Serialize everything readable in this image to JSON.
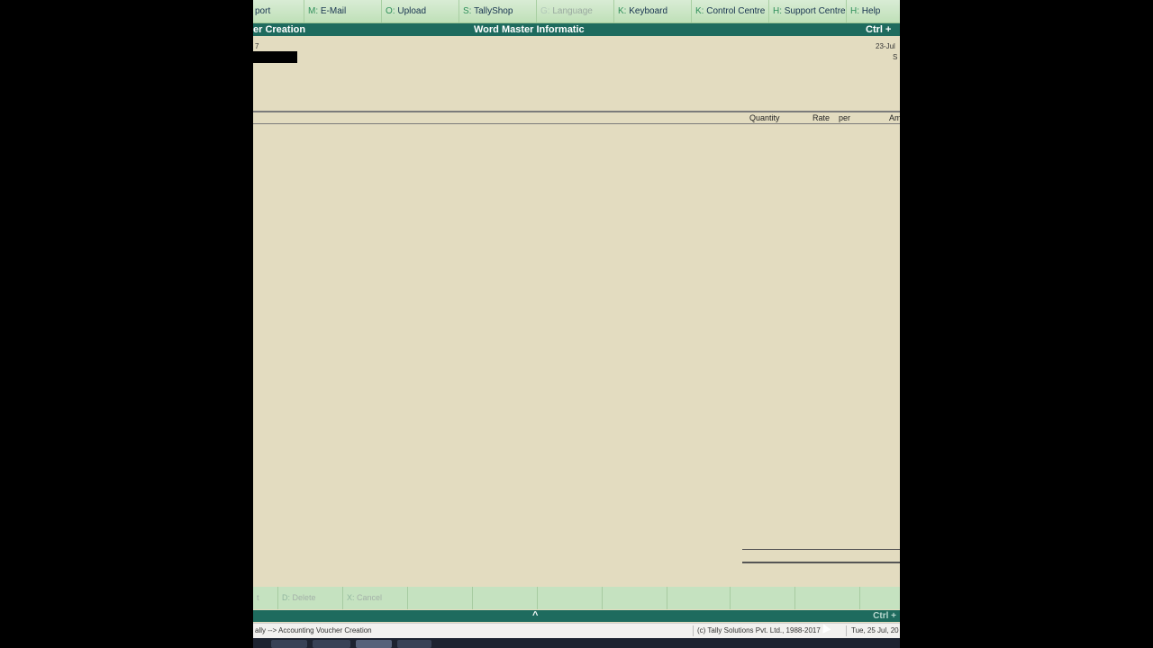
{
  "top_menu": [
    {
      "key": "",
      "label": "port"
    },
    {
      "key": "M:",
      "label": "E-Mail"
    },
    {
      "key": "O:",
      "label": "Upload"
    },
    {
      "key": "S:",
      "label": "TallyShop"
    },
    {
      "key": "G:",
      "label": "Language",
      "disabled": true
    },
    {
      "key": "K:",
      "label": "Keyboard"
    },
    {
      "key": "K:",
      "label": "Control Centre"
    },
    {
      "key": "H:",
      "label": "Support Centre"
    },
    {
      "key": "H:",
      "label": "Help"
    }
  ],
  "title_bar": {
    "left": "er  Creation",
    "center": "Word Master Informatic",
    "right": "Ctrl + "
  },
  "voucher_header": {
    "number_fragment": "7",
    "date_fragment": "23-Jul",
    "day_fragment": "S"
  },
  "columns": {
    "quantity": "Quantity",
    "rate": "Rate",
    "per": "per",
    "amount": "Am"
  },
  "bottom_buttons": [
    {
      "key": "",
      "label": "t"
    },
    {
      "key": "D:",
      "label": "Delete"
    },
    {
      "key": "X:",
      "label": "Cancel"
    },
    {
      "key": "",
      "label": ""
    },
    {
      "key": "",
      "label": ""
    },
    {
      "key": "",
      "label": ""
    },
    {
      "key": "",
      "label": ""
    },
    {
      "key": "",
      "label": ""
    },
    {
      "key": "",
      "label": ""
    },
    {
      "key": "",
      "label": ""
    },
    {
      "key": "",
      "label": ""
    }
  ],
  "lower_strip": {
    "arrow": "^",
    "ctrl": "Ctrl + "
  },
  "status_bar": {
    "path": "ally --> Accounting Voucher  Creation",
    "copyright": "(c) Tally Solutions Pvt. Ltd., 1988-2017",
    "datetime": "Tue, 25 Jul, 20"
  },
  "colors": {
    "background": "#e3dcc0",
    "title_bar": "#1e6b5e",
    "menu_bar": "#c8e6c2"
  }
}
